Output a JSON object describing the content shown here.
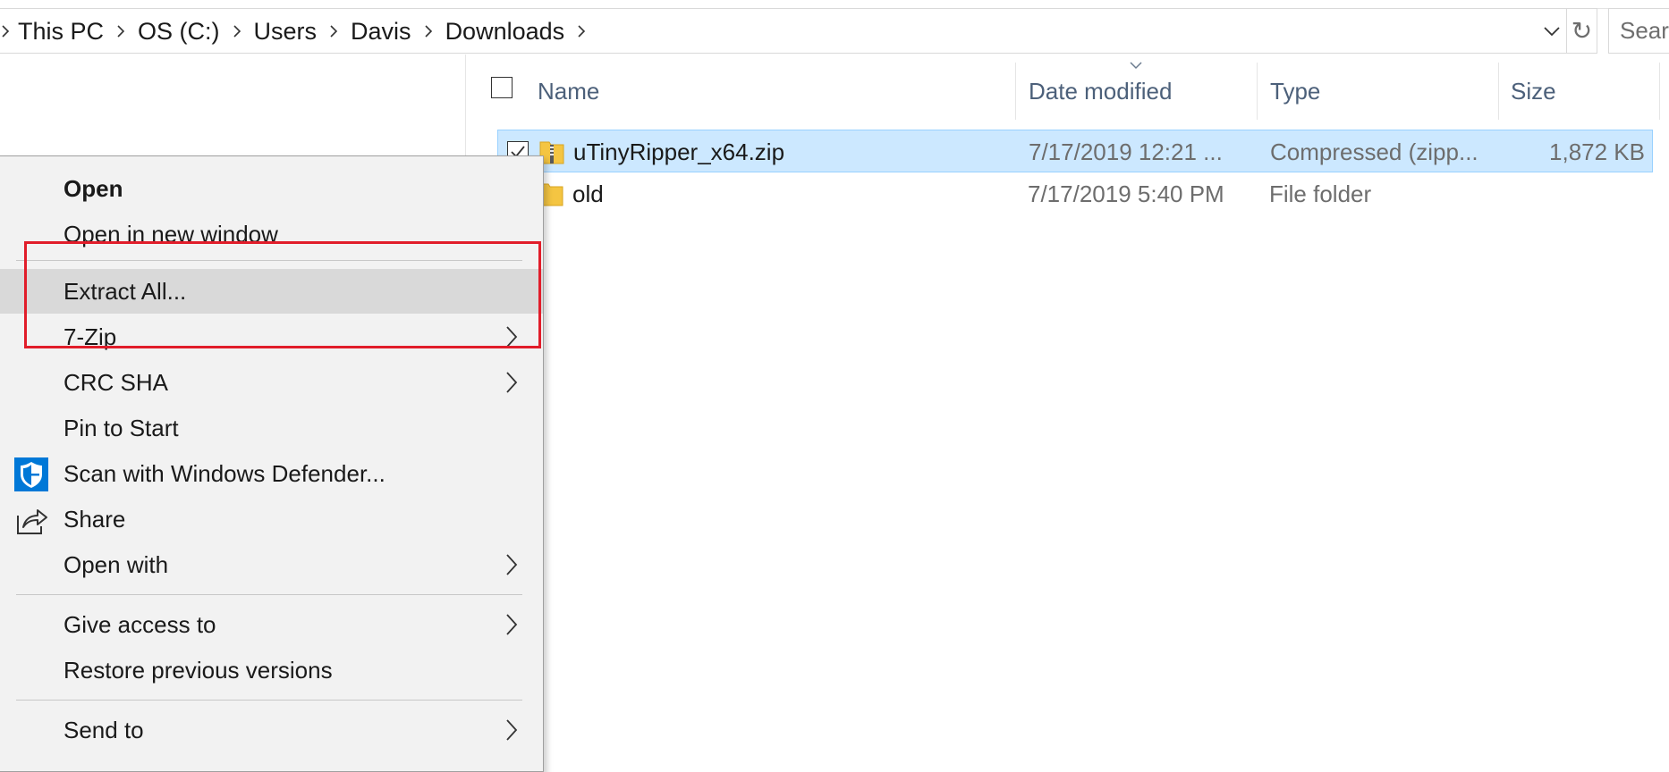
{
  "address_bar": {
    "crumbs": [
      "This PC",
      "OS (C:)",
      "Users",
      "Davis",
      "Downloads"
    ],
    "refresh_glyph": "↻",
    "search_placeholder": "Search Downloads"
  },
  "file_list": {
    "columns": {
      "name": "Name",
      "date": "Date modified",
      "type": "Type",
      "size": "Size"
    },
    "rows": [
      {
        "name": "uTinyRipper_x64.zip",
        "date": "7/17/2019 12:21 ...",
        "type": "Compressed (zipp...",
        "size": "1,872 KB",
        "icon": "zip-folder-icon",
        "selected": true,
        "checked": true
      },
      {
        "name": "old",
        "date": "7/17/2019 5:40 PM",
        "type": "File folder",
        "size": "",
        "icon": "folder-icon",
        "selected": false,
        "checked": false
      }
    ]
  },
  "context_menu": {
    "open": "Open",
    "open_new_window": "Open in new window",
    "extract_all": "Extract All...",
    "seven_zip": "7-Zip",
    "crc_sha": "CRC SHA",
    "pin_to_start": "Pin to Start",
    "scan_defender": "Scan with Windows Defender...",
    "share": "Share",
    "open_with": "Open with",
    "give_access": "Give access to",
    "restore_versions": "Restore previous versions",
    "send_to": "Send to",
    "hovered_item": "Extract All..."
  },
  "colors": {
    "selection_bg": "#cce8ff",
    "selection_border": "#99d1ff",
    "menu_bg": "#f2f2f2",
    "menu_hover": "#d9d9d9",
    "highlight_box": "#e11d2a",
    "header_text": "#4c607a",
    "defender_blue": "#0078d7",
    "folder_yellow": "#f4c542"
  }
}
